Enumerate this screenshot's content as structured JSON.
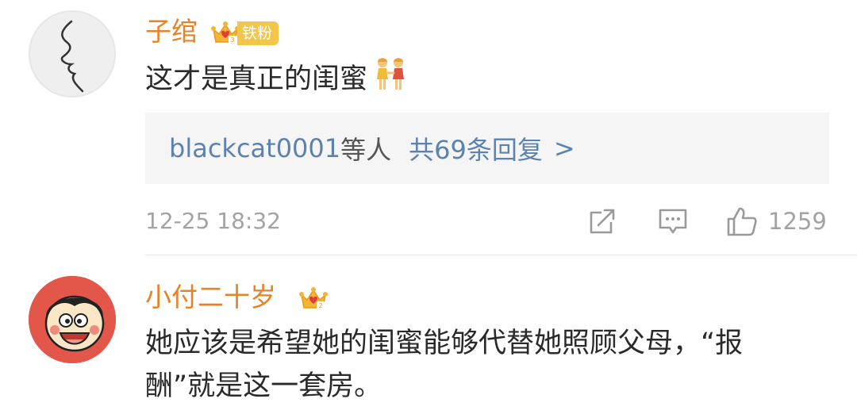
{
  "comments": [
    {
      "username": "子绾",
      "badge": "铁粉",
      "text": "这才是真正的闺蜜",
      "emoji": "two-women-holding-hands-emoji",
      "replies": {
        "users": "blackcat0001",
        "others": "等人",
        "count": "共69条回复",
        "arrow": ">"
      },
      "time": "12-25 18:32",
      "likes": "1259"
    },
    {
      "username": "小付二十岁",
      "text_line1": "她应该是希望她的闺蜜能够代替她照顾父母，“报",
      "text_line2": "酬”就是这一套房。"
    }
  ],
  "icons": {
    "share": "share-icon",
    "comment": "comment-icon",
    "like": "like-icon",
    "crown": "crown-icon"
  },
  "colors": {
    "username": "#e78226",
    "link": "#5c82ad",
    "meta": "#a3a3a3",
    "badge": "#f2c64b",
    "reply_background": "#f5f5f5"
  }
}
